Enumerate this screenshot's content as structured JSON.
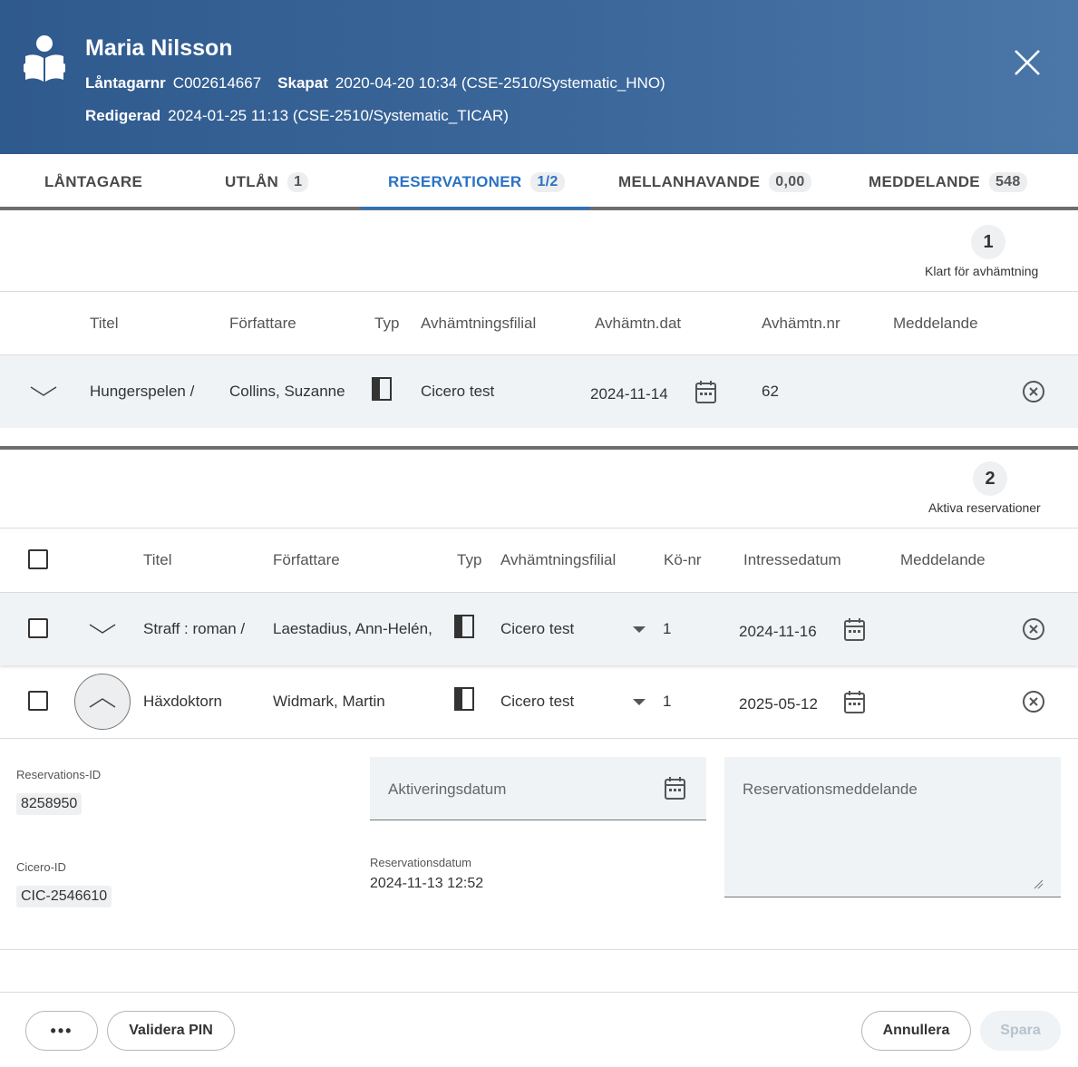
{
  "header": {
    "name": "Maria Nilsson",
    "borrower_label": "Låntagarnr",
    "borrower_value": "C002614667",
    "created_label": "Skapat",
    "created_value": "2020-04-20 10:34 (CSE-2510/Systematic_HNO)",
    "edited_label": "Redigerad",
    "edited_value": "2024-01-25 11:13 (CSE-2510/Systematic_TICAR)",
    "avatar_icon": "reader-icon",
    "close_icon": "close-icon"
  },
  "tabs": [
    {
      "label": "LÅNTAGARE",
      "badge": ""
    },
    {
      "label": "UTLÅN",
      "badge": "1"
    },
    {
      "label": "RESERVATIONER",
      "badge": "1/2",
      "active": true
    },
    {
      "label": "MELLANHAVANDE",
      "badge": "0,00"
    },
    {
      "label": "MEDDELANDE",
      "badge": "548"
    }
  ],
  "ready_section": {
    "count": "1",
    "label": "Klart för avhämtning",
    "columns": [
      "Titel",
      "Författare",
      "Typ",
      "Avhämtningsfilial",
      "Avhämtn.dat",
      "Avhämtn.nr",
      "Meddelande"
    ],
    "rows": [
      {
        "title": "Hungerspelen /",
        "author": "Collins, Suzanne",
        "type_icon": "book-icon",
        "branch": "Cicero test",
        "pickup_date": "2024-11-14",
        "pickup_nr": "62",
        "message": ""
      }
    ]
  },
  "active_section": {
    "count": "2",
    "label": "Aktiva reservationer",
    "columns": [
      "Titel",
      "Författare",
      "Typ",
      "Avhämtningsfilial",
      "Kö-nr",
      "Intressedatum",
      "Meddelande"
    ],
    "rows": [
      {
        "title": "Straff : roman /",
        "author": "Laestadius, Ann-Helén,",
        "type_icon": "book-icon",
        "branch": "Cicero test",
        "queue": "1",
        "interest_date": "2024-11-16"
      },
      {
        "title": "Häxdoktorn",
        "author": "Widmark, Martin",
        "type_icon": "book-icon",
        "branch": "Cicero test",
        "queue": "1",
        "interest_date": "2025-05-12"
      }
    ]
  },
  "details": {
    "reservation_id_label": "Reservations-ID",
    "reservation_id": "8258950",
    "cicero_id_label": "Cicero-ID",
    "cicero_id": "CIC-2546610",
    "activation_placeholder": "Aktiveringsdatum",
    "reservation_date_label": "Reservationsdatum",
    "reservation_date": "2024-11-13 12:52",
    "message_placeholder": "Reservationsmeddelande"
  },
  "footer": {
    "more_label": "•••",
    "validate_label": "Validera PIN",
    "cancel_label": "Annullera",
    "save_label": "Spara"
  },
  "colors": {
    "header_bg": "#3b679b",
    "accent": "#2a72c4",
    "row_bg": "#eff3f6"
  }
}
